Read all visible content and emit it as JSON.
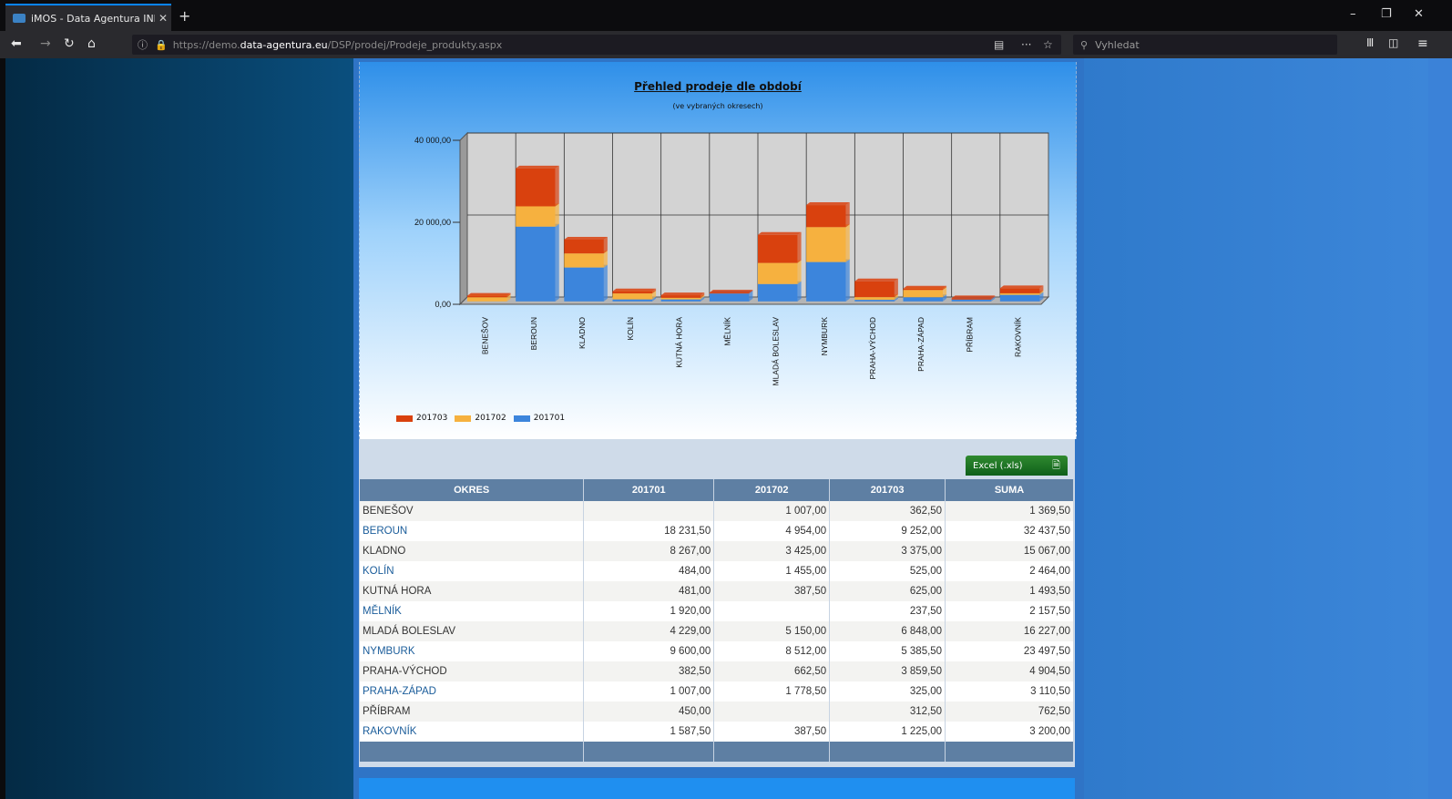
{
  "browser": {
    "tab_title": "iMOS - Data Agentura INFOPH",
    "url_prefix": "https://demo.",
    "url_domain": "data-agentura.eu",
    "url_path": "/DSP/prodej/Prodeje_produkty.aspx",
    "search_placeholder": "Vyhledat"
  },
  "chart": {
    "title": "Přehled prodeje dle období",
    "subtitle": "(ve vybraných okresech)",
    "excel_label": "Excel (.xls)"
  },
  "chart_data": {
    "type": "bar",
    "stacked": true,
    "categories": [
      "BENEŠOV",
      "BEROUN",
      "KLADNO",
      "KOLÍN",
      "KUTNÁ HORA",
      "MĚLNÍK",
      "MLADÁ BOLESLAV",
      "NYMBURK",
      "PRAHA-VÝCHOD",
      "PRAHA-ZÁPAD",
      "PŘÍBRAM",
      "RAKOVNÍK"
    ],
    "series": [
      {
        "name": "201701",
        "color": "#3c85dc",
        "values": [
          0,
          18231.5,
          8267,
          484,
          481,
          1920,
          4229,
          9600,
          382.5,
          1007,
          450,
          1587.5
        ]
      },
      {
        "name": "201702",
        "color": "#f6b13f",
        "values": [
          1007,
          4954,
          3425,
          1455,
          387.5,
          0,
          5150,
          8512,
          662.5,
          1778.5,
          0,
          387.5
        ]
      },
      {
        "name": "201703",
        "color": "#d9410e",
        "values": [
          362.5,
          9252,
          3375,
          525,
          625,
          237.5,
          6848,
          5385.5,
          3859.5,
          325,
          312.5,
          1225
        ]
      }
    ],
    "yticks": [
      "0,00",
      "20 000,00",
      "40 000,00"
    ],
    "ylim": [
      0,
      40000
    ],
    "legend_order": [
      "201703",
      "201702",
      "201701"
    ],
    "legend_position": "bottom-left"
  },
  "table": {
    "headers": [
      "OKRES",
      "201701",
      "201702",
      "201703",
      "SUMA"
    ],
    "rows": [
      [
        "BENEŠOV",
        "",
        "1 007,00",
        "362,50",
        "1 369,50"
      ],
      [
        "BEROUN",
        "18 231,50",
        "4 954,00",
        "9 252,00",
        "32 437,50"
      ],
      [
        "KLADNO",
        "8 267,00",
        "3 425,00",
        "3 375,00",
        "15 067,00"
      ],
      [
        "KOLÍN",
        "484,00",
        "1 455,00",
        "525,00",
        "2 464,00"
      ],
      [
        "KUTNÁ HORA",
        "481,00",
        "387,50",
        "625,00",
        "1 493,50"
      ],
      [
        "MĚLNÍK",
        "1 920,00",
        "",
        "237,50",
        "2 157,50"
      ],
      [
        "MLADÁ BOLESLAV",
        "4 229,00",
        "5 150,00",
        "6 848,00",
        "16 227,00"
      ],
      [
        "NYMBURK",
        "9 600,00",
        "8 512,00",
        "5 385,50",
        "23 497,50"
      ],
      [
        "PRAHA-VÝCHOD",
        "382,50",
        "662,50",
        "3 859,50",
        "4 904,50"
      ],
      [
        "PRAHA-ZÁPAD",
        "1 007,00",
        "1 778,50",
        "325,00",
        "3 110,50"
      ],
      [
        "PŘÍBRAM",
        "450,00",
        "",
        "312,50",
        "762,50"
      ],
      [
        "RAKOVNÍK",
        "1 587,50",
        "387,50",
        "1 225,00",
        "3 200,00"
      ]
    ]
  }
}
